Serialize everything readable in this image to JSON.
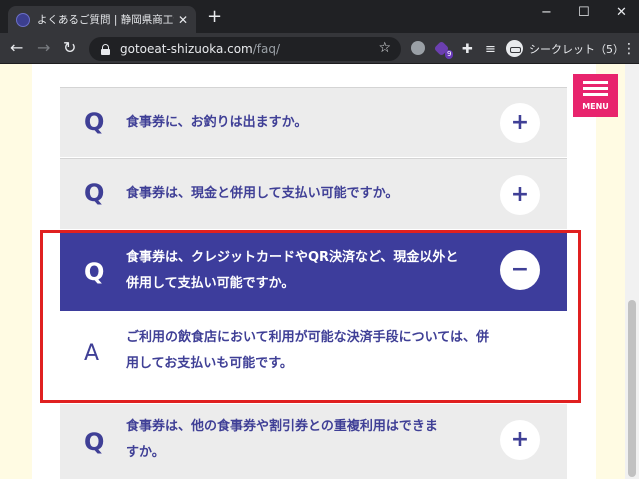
{
  "browser": {
    "tab_title": "よくあるご質問 | 静岡県商工会Go To",
    "tab_close": "✕",
    "new_tab": "+",
    "window_controls": {
      "minimize": "−",
      "maximize": "☐",
      "close": "✕"
    },
    "nav": {
      "back": "←",
      "forward": "→",
      "reload": "↻"
    },
    "url_host": "gotoeat-shizuoka.com",
    "url_path": "/faq/",
    "extension_badge": "9",
    "profile_label": "シークレット（5）"
  },
  "menu": {
    "label": "MENU"
  },
  "faq": {
    "items": [
      {
        "q": "Q",
        "text": "食事券に、お釣りは出ますか。",
        "toggle": "+"
      },
      {
        "q": "Q",
        "text": "食事券は、現金と併用して支払い可能ですか。",
        "toggle": "+"
      },
      {
        "q": "Q",
        "text_line1": "食事券は、クレジットカードやQR決済など、現金以外と",
        "text_line2": "併用して支払い可能ですか。",
        "toggle": "−",
        "answer": {
          "a": "A",
          "line1": "ご利用の飲食店において利用が可能な決済手段については、併",
          "line2": "用してお支払いも可能です。"
        }
      },
      {
        "q": "Q",
        "text_line1": "食事券は、他の食事券や割引券との重複利用はできま",
        "text_line2": "すか。",
        "toggle": "+"
      }
    ]
  },
  "colors": {
    "accent": "#3d3d9c",
    "menu": "#e8246d",
    "highlight": "#e02020",
    "side_bg": "#fffbe3"
  }
}
